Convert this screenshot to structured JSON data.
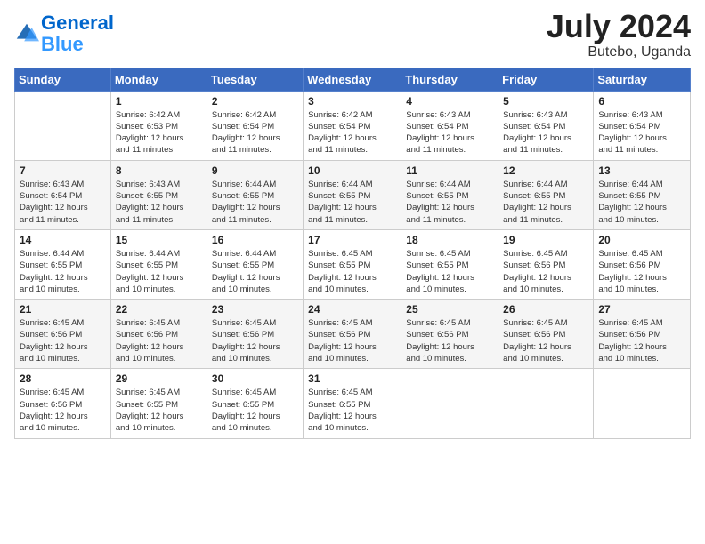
{
  "logo": {
    "line1": "General",
    "line2": "Blue"
  },
  "title": {
    "month_year": "July 2024",
    "location": "Butebo, Uganda"
  },
  "weekdays": [
    "Sunday",
    "Monday",
    "Tuesday",
    "Wednesday",
    "Thursday",
    "Friday",
    "Saturday"
  ],
  "weeks": [
    [
      {
        "day": "",
        "info": ""
      },
      {
        "day": "1",
        "info": "Sunrise: 6:42 AM\nSunset: 6:53 PM\nDaylight: 12 hours\nand 11 minutes."
      },
      {
        "day": "2",
        "info": "Sunrise: 6:42 AM\nSunset: 6:54 PM\nDaylight: 12 hours\nand 11 minutes."
      },
      {
        "day": "3",
        "info": "Sunrise: 6:42 AM\nSunset: 6:54 PM\nDaylight: 12 hours\nand 11 minutes."
      },
      {
        "day": "4",
        "info": "Sunrise: 6:43 AM\nSunset: 6:54 PM\nDaylight: 12 hours\nand 11 minutes."
      },
      {
        "day": "5",
        "info": "Sunrise: 6:43 AM\nSunset: 6:54 PM\nDaylight: 12 hours\nand 11 minutes."
      },
      {
        "day": "6",
        "info": "Sunrise: 6:43 AM\nSunset: 6:54 PM\nDaylight: 12 hours\nand 11 minutes."
      }
    ],
    [
      {
        "day": "7",
        "info": "Sunrise: 6:43 AM\nSunset: 6:54 PM\nDaylight: 12 hours\nand 11 minutes."
      },
      {
        "day": "8",
        "info": "Sunrise: 6:43 AM\nSunset: 6:55 PM\nDaylight: 12 hours\nand 11 minutes."
      },
      {
        "day": "9",
        "info": "Sunrise: 6:44 AM\nSunset: 6:55 PM\nDaylight: 12 hours\nand 11 minutes."
      },
      {
        "day": "10",
        "info": "Sunrise: 6:44 AM\nSunset: 6:55 PM\nDaylight: 12 hours\nand 11 minutes."
      },
      {
        "day": "11",
        "info": "Sunrise: 6:44 AM\nSunset: 6:55 PM\nDaylight: 12 hours\nand 11 minutes."
      },
      {
        "day": "12",
        "info": "Sunrise: 6:44 AM\nSunset: 6:55 PM\nDaylight: 12 hours\nand 11 minutes."
      },
      {
        "day": "13",
        "info": "Sunrise: 6:44 AM\nSunset: 6:55 PM\nDaylight: 12 hours\nand 10 minutes."
      }
    ],
    [
      {
        "day": "14",
        "info": "Sunrise: 6:44 AM\nSunset: 6:55 PM\nDaylight: 12 hours\nand 10 minutes."
      },
      {
        "day": "15",
        "info": "Sunrise: 6:44 AM\nSunset: 6:55 PM\nDaylight: 12 hours\nand 10 minutes."
      },
      {
        "day": "16",
        "info": "Sunrise: 6:44 AM\nSunset: 6:55 PM\nDaylight: 12 hours\nand 10 minutes."
      },
      {
        "day": "17",
        "info": "Sunrise: 6:45 AM\nSunset: 6:55 PM\nDaylight: 12 hours\nand 10 minutes."
      },
      {
        "day": "18",
        "info": "Sunrise: 6:45 AM\nSunset: 6:55 PM\nDaylight: 12 hours\nand 10 minutes."
      },
      {
        "day": "19",
        "info": "Sunrise: 6:45 AM\nSunset: 6:56 PM\nDaylight: 12 hours\nand 10 minutes."
      },
      {
        "day": "20",
        "info": "Sunrise: 6:45 AM\nSunset: 6:56 PM\nDaylight: 12 hours\nand 10 minutes."
      }
    ],
    [
      {
        "day": "21",
        "info": "Sunrise: 6:45 AM\nSunset: 6:56 PM\nDaylight: 12 hours\nand 10 minutes."
      },
      {
        "day": "22",
        "info": "Sunrise: 6:45 AM\nSunset: 6:56 PM\nDaylight: 12 hours\nand 10 minutes."
      },
      {
        "day": "23",
        "info": "Sunrise: 6:45 AM\nSunset: 6:56 PM\nDaylight: 12 hours\nand 10 minutes."
      },
      {
        "day": "24",
        "info": "Sunrise: 6:45 AM\nSunset: 6:56 PM\nDaylight: 12 hours\nand 10 minutes."
      },
      {
        "day": "25",
        "info": "Sunrise: 6:45 AM\nSunset: 6:56 PM\nDaylight: 12 hours\nand 10 minutes."
      },
      {
        "day": "26",
        "info": "Sunrise: 6:45 AM\nSunset: 6:56 PM\nDaylight: 12 hours\nand 10 minutes."
      },
      {
        "day": "27",
        "info": "Sunrise: 6:45 AM\nSunset: 6:56 PM\nDaylight: 12 hours\nand 10 minutes."
      }
    ],
    [
      {
        "day": "28",
        "info": "Sunrise: 6:45 AM\nSunset: 6:56 PM\nDaylight: 12 hours\nand 10 minutes."
      },
      {
        "day": "29",
        "info": "Sunrise: 6:45 AM\nSunset: 6:55 PM\nDaylight: 12 hours\nand 10 minutes."
      },
      {
        "day": "30",
        "info": "Sunrise: 6:45 AM\nSunset: 6:55 PM\nDaylight: 12 hours\nand 10 minutes."
      },
      {
        "day": "31",
        "info": "Sunrise: 6:45 AM\nSunset: 6:55 PM\nDaylight: 12 hours\nand 10 minutes."
      },
      {
        "day": "",
        "info": ""
      },
      {
        "day": "",
        "info": ""
      },
      {
        "day": "",
        "info": ""
      }
    ]
  ]
}
